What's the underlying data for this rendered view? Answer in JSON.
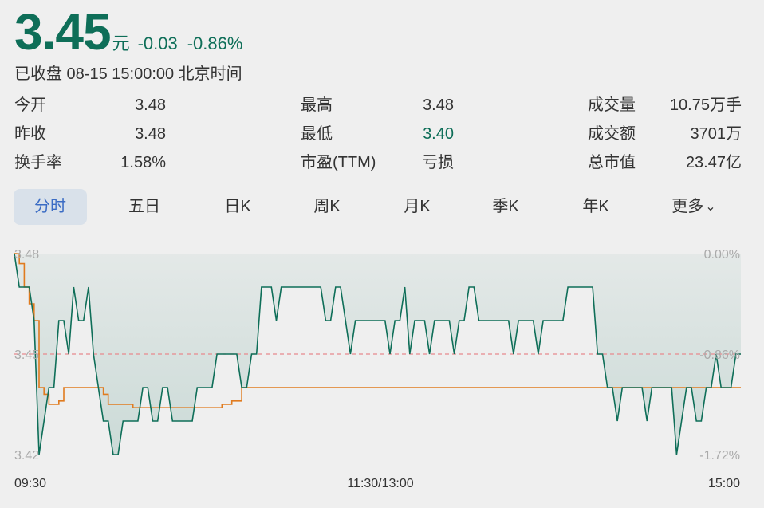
{
  "quote": {
    "price": "3.45",
    "unit": "元",
    "change": "-0.03",
    "change_pct": "-0.86%",
    "status": "已收盘 08-15 15:00:00 北京时间"
  },
  "stats": [
    [
      {
        "label": "今开",
        "value": "3.48"
      },
      {
        "label": "最高",
        "value": "3.48"
      },
      {
        "label": "成交量",
        "value": "10.75万手"
      }
    ],
    [
      {
        "label": "昨收",
        "value": "3.48"
      },
      {
        "label": "最低",
        "value": "3.40"
      },
      {
        "label": "成交额",
        "value": "3701万"
      }
    ],
    [
      {
        "label": "换手率",
        "value": "1.58%"
      },
      {
        "label": "市盈(TTM)",
        "value": "亏损"
      },
      {
        "label": "总市值",
        "value": "23.47亿"
      }
    ]
  ],
  "tabs": [
    "分时",
    "五日",
    "日K",
    "周K",
    "月K",
    "季K",
    "年K",
    "更多"
  ],
  "active_tab": 0,
  "colors": {
    "price_line": "#0e6e58",
    "avg_line": "#e07b1f",
    "ref_line": "#e8898d",
    "down": "#0e6e58",
    "axis_text": "#aaaaaa"
  },
  "chart_data": {
    "type": "line",
    "ylim": [
      3.42,
      3.48
    ],
    "y_ticks_left": [
      "3.48",
      "3.45",
      "3.42"
    ],
    "y_ticks_right": [
      "0.00%",
      "-0.86%",
      "-1.72%"
    ],
    "reference_price": 3.45,
    "x_ticks": [
      "09:30",
      "11:30/13:00",
      "15:00"
    ],
    "series": [
      {
        "values": [
          3.48,
          3.47,
          3.47,
          3.47,
          3.46,
          3.42,
          3.43,
          3.44,
          3.44,
          3.46,
          3.46,
          3.45,
          3.47,
          3.46,
          3.46,
          3.47,
          3.45,
          3.44,
          3.43,
          3.43,
          3.42,
          3.42,
          3.43,
          3.43,
          3.43,
          3.43,
          3.44,
          3.44,
          3.43,
          3.43,
          3.44,
          3.44,
          3.43,
          3.43,
          3.43,
          3.43,
          3.43,
          3.44,
          3.44,
          3.44,
          3.44,
          3.45,
          3.45,
          3.45,
          3.45,
          3.45,
          3.44,
          3.44,
          3.45,
          3.45,
          3.47,
          3.47,
          3.47,
          3.46,
          3.47,
          3.47,
          3.47,
          3.47,
          3.47,
          3.47,
          3.47,
          3.47,
          3.47,
          3.46,
          3.46,
          3.47,
          3.47,
          3.46,
          3.45,
          3.46,
          3.46,
          3.46,
          3.46,
          3.46,
          3.46,
          3.46,
          3.45,
          3.46,
          3.46,
          3.47,
          3.45,
          3.46,
          3.46,
          3.46,
          3.45,
          3.46,
          3.46,
          3.46,
          3.46,
          3.45,
          3.46,
          3.46,
          3.47,
          3.47,
          3.46,
          3.46,
          3.46,
          3.46,
          3.46,
          3.46,
          3.46,
          3.45,
          3.46,
          3.46,
          3.46,
          3.46,
          3.45,
          3.46,
          3.46,
          3.46,
          3.46,
          3.46,
          3.47,
          3.47,
          3.47,
          3.47,
          3.47,
          3.47,
          3.45,
          3.45,
          3.44,
          3.44,
          3.43,
          3.44,
          3.44,
          3.44,
          3.44,
          3.44,
          3.43,
          3.44,
          3.44,
          3.44,
          3.44,
          3.44,
          3.42,
          3.43,
          3.44,
          3.44,
          3.43,
          3.43,
          3.44,
          3.44,
          3.45,
          3.44,
          3.44,
          3.44,
          3.45,
          3.45
        ]
      },
      {
        "values": [
          3.48,
          3.477,
          3.47,
          3.465,
          3.46,
          3.44,
          3.438,
          3.435,
          3.435,
          3.436,
          3.44,
          3.44,
          3.44,
          3.44,
          3.44,
          3.44,
          3.44,
          3.44,
          3.438,
          3.435,
          3.435,
          3.435,
          3.435,
          3.435,
          3.434,
          3.434,
          3.434,
          3.434,
          3.434,
          3.434,
          3.434,
          3.434,
          3.434,
          3.434,
          3.434,
          3.434,
          3.434,
          3.434,
          3.434,
          3.434,
          3.434,
          3.434,
          3.435,
          3.435,
          3.436,
          3.436,
          3.44,
          3.44,
          3.44,
          3.44,
          3.44,
          3.44,
          3.44,
          3.44,
          3.44,
          3.44,
          3.44,
          3.44,
          3.44,
          3.44,
          3.44,
          3.44,
          3.44,
          3.44,
          3.44,
          3.44,
          3.44,
          3.44,
          3.44,
          3.44,
          3.44,
          3.44,
          3.44,
          3.44,
          3.44,
          3.44,
          3.44,
          3.44,
          3.44,
          3.44,
          3.44,
          3.44,
          3.44,
          3.44,
          3.44,
          3.44,
          3.44,
          3.44,
          3.44,
          3.44,
          3.44,
          3.44,
          3.44,
          3.44,
          3.44,
          3.44,
          3.44,
          3.44,
          3.44,
          3.44,
          3.44,
          3.44,
          3.44,
          3.44,
          3.44,
          3.44,
          3.44,
          3.44,
          3.44,
          3.44,
          3.44,
          3.44,
          3.44,
          3.44,
          3.44,
          3.44,
          3.44,
          3.44,
          3.44,
          3.44,
          3.44,
          3.44,
          3.44,
          3.44,
          3.44,
          3.44,
          3.44,
          3.44,
          3.44,
          3.44,
          3.44,
          3.44,
          3.44,
          3.44,
          3.44,
          3.44,
          3.44,
          3.44,
          3.44,
          3.44,
          3.44,
          3.44,
          3.44,
          3.44,
          3.44,
          3.44,
          3.44,
          3.44
        ]
      }
    ]
  }
}
